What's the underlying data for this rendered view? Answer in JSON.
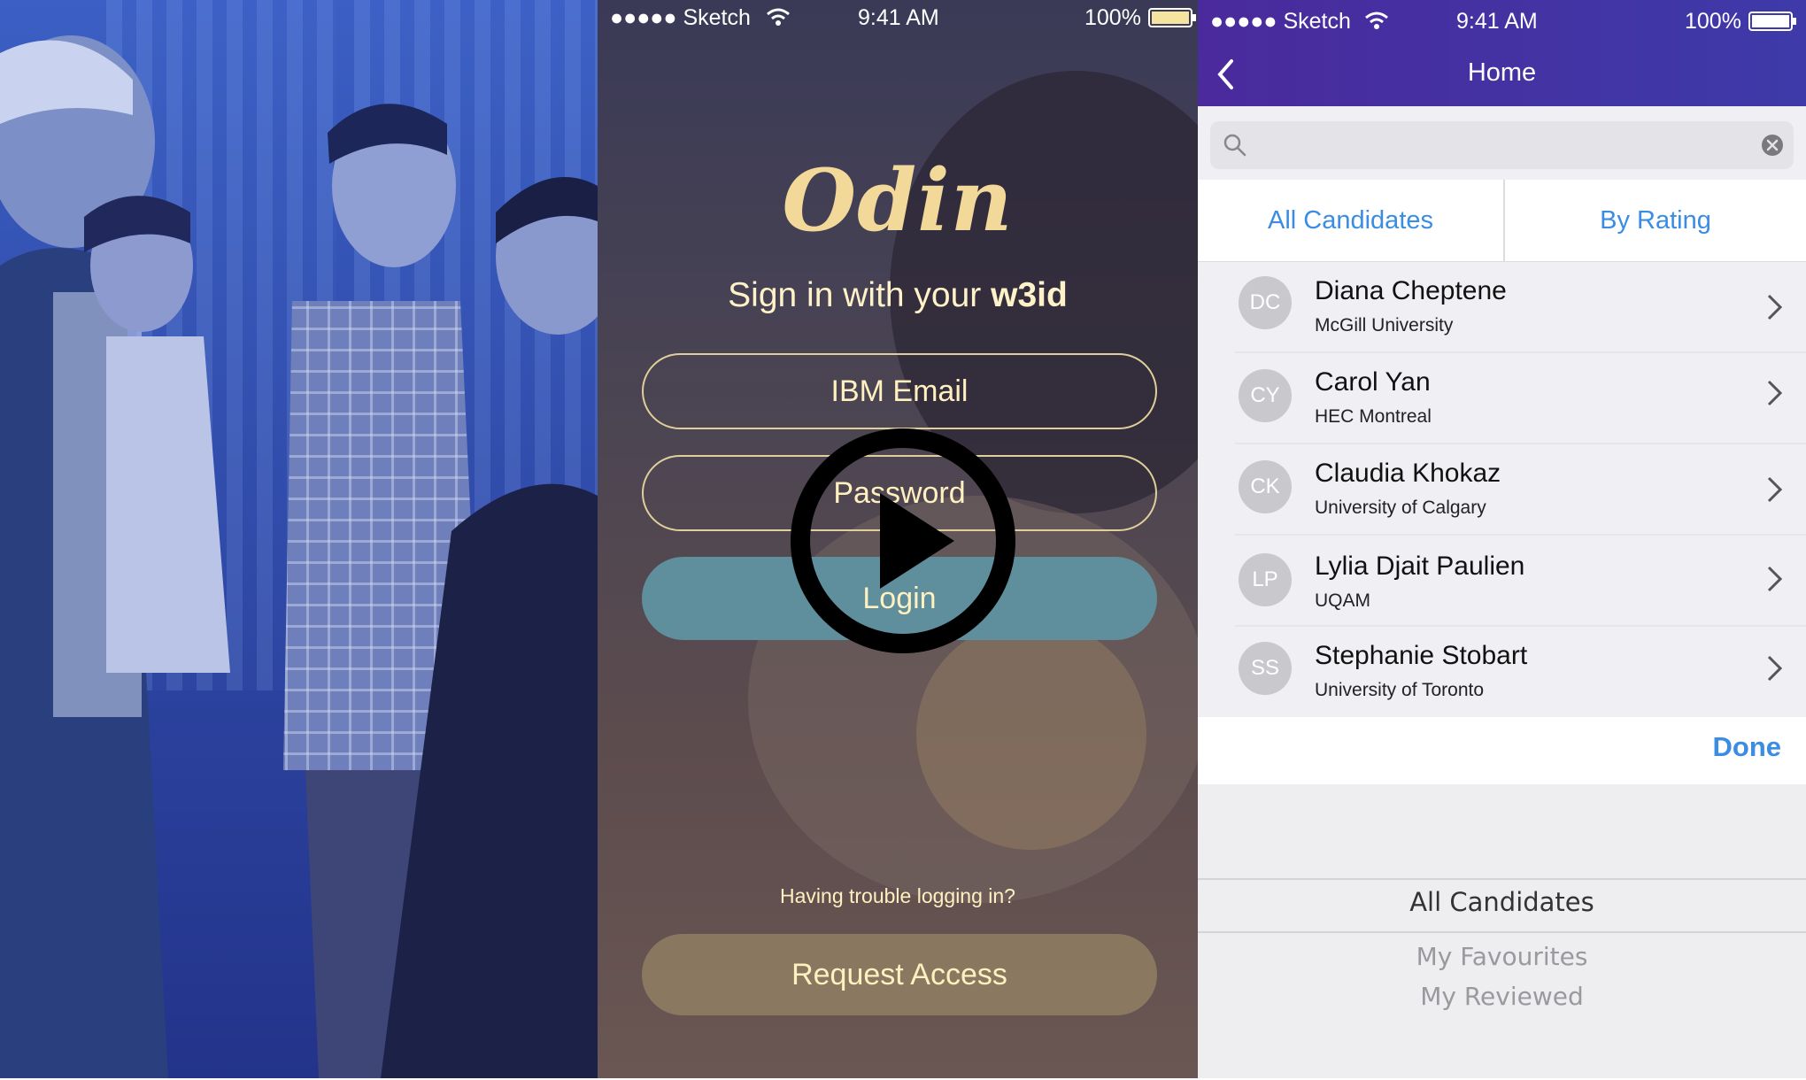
{
  "login": {
    "status_carrier": "●●●●● Sketch",
    "status_time": "9:41 AM",
    "status_battery": "100%",
    "logo": "Odin",
    "headline_prefix": "Sign in with your",
    "headline_bold": "w3id",
    "email_placeholder": "IBM Email",
    "password_placeholder": "Password",
    "login_label": "Login",
    "trouble_text": "Having trouble logging in?",
    "request_label": "Request Access"
  },
  "home": {
    "status_carrier": "●●●●● Sketch",
    "status_time": "9:41 AM",
    "status_battery": "100%",
    "title": "Home",
    "search_value": "",
    "tabs": [
      "All Candidates",
      "By Rating"
    ],
    "candidates": [
      {
        "initials": "DC",
        "name": "Diana Cheptene",
        "school": "McGill University"
      },
      {
        "initials": "CY",
        "name": "Carol Yan",
        "school": "HEC Montreal"
      },
      {
        "initials": "CK",
        "name": "Claudia Khokaz",
        "school": "University of Calgary"
      },
      {
        "initials": "LP",
        "name": "Lylia Djait Paulien",
        "school": "UQAM"
      },
      {
        "initials": "SS",
        "name": "Stephanie Stobart",
        "school": "University of Toronto"
      }
    ],
    "done_label": "Done",
    "picker_options": [
      "All Candidates",
      "My Favourites",
      "My Reviewed"
    ]
  },
  "colors": {
    "nav_purple": "#4a2a9c",
    "link_blue": "#3a8de2",
    "login_gold": "#f2d99a",
    "login_button": "#5f8f9c"
  },
  "icons": {
    "play": "play-icon",
    "back": "chevron-left-icon",
    "search": "search-icon",
    "clear": "clear-icon",
    "row": "chevron-right-icon",
    "wifi": "wifi-icon",
    "battery": "battery-icon"
  }
}
